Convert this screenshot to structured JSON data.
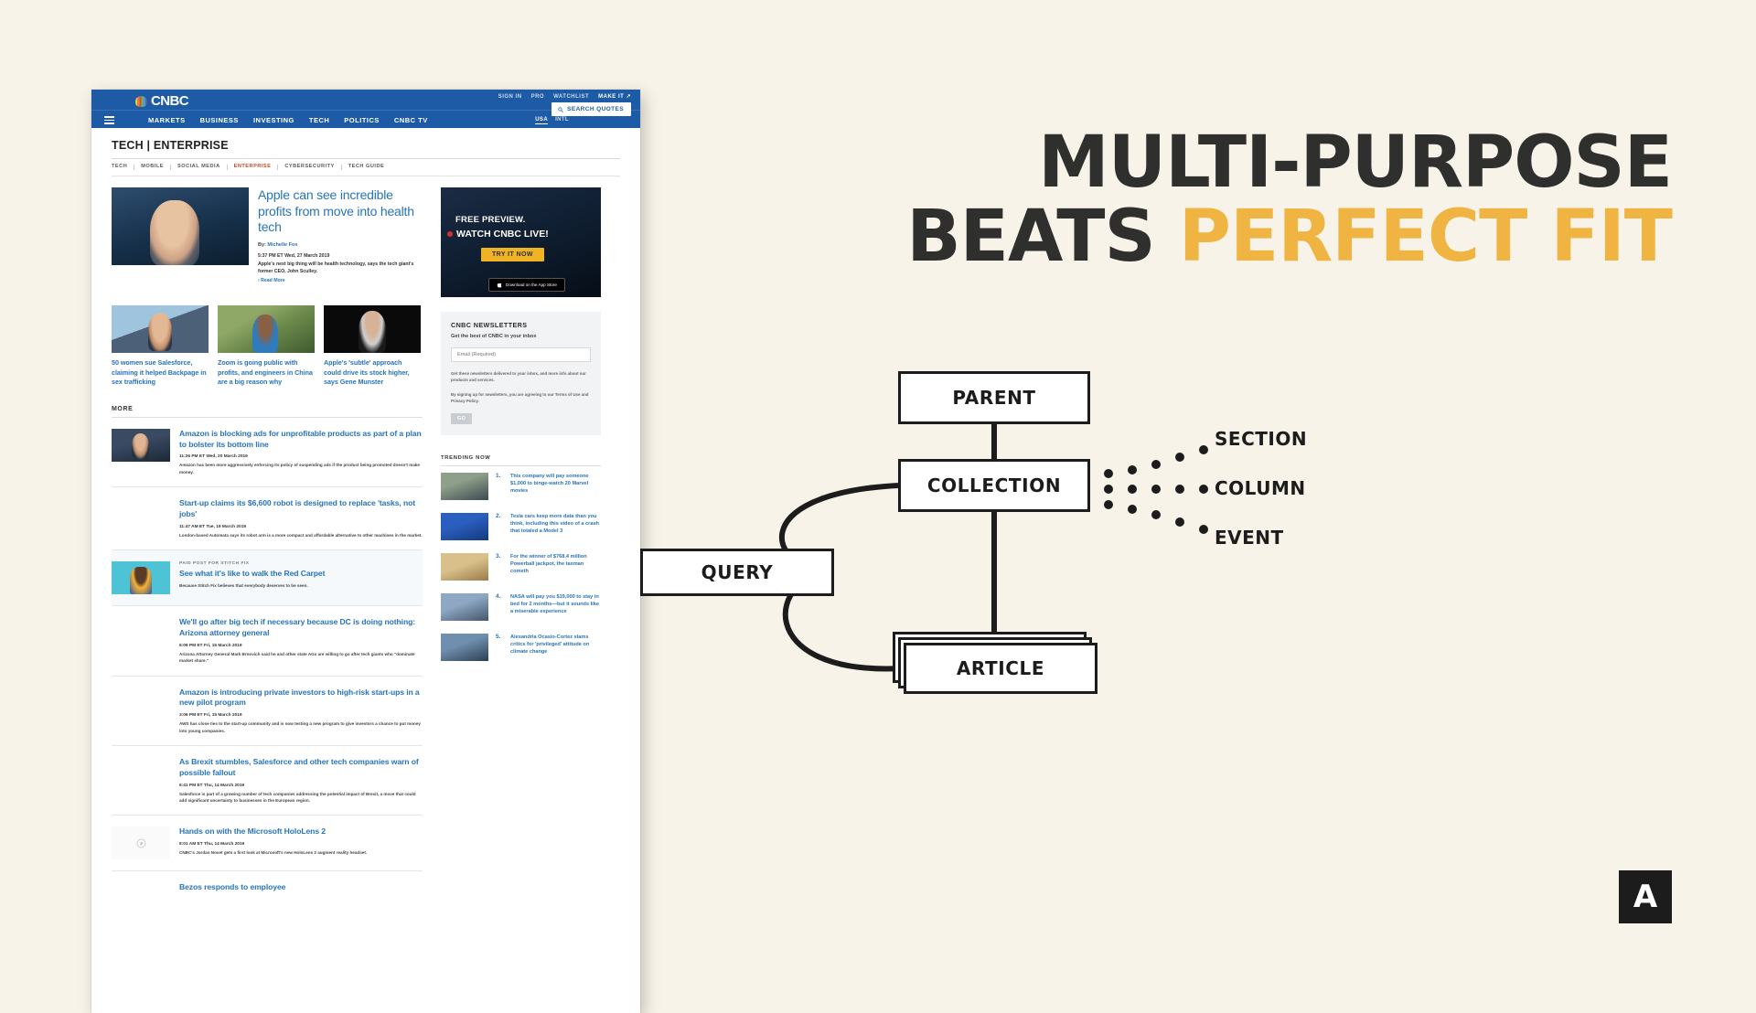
{
  "headline": {
    "line1": "MULTI-PURPOSE",
    "line2_dark": "BEATS ",
    "line2_accent": "PERFECT FIT"
  },
  "colors": {
    "background": "#f7f3e8",
    "accent": "#f0b442",
    "ink": "#2f2f2d",
    "cnbc_blue": "#1d5ba6",
    "link_blue": "#2774b9"
  },
  "diagram": {
    "nodes": [
      {
        "id": "parent",
        "label": "PARENT"
      },
      {
        "id": "collection",
        "label": "COLLECTION"
      },
      {
        "id": "query",
        "label": "QUERY"
      },
      {
        "id": "article",
        "label": "ARTICLE"
      }
    ],
    "legend": [
      "SECTION",
      "COLUMN",
      "EVENT"
    ]
  },
  "brand": {
    "mark": "A"
  },
  "browser": {
    "header": {
      "logo": "CNBC",
      "utility": [
        "SIGN IN",
        "PRO",
        "WATCHLIST",
        "MAKE IT ↗"
      ],
      "nav": [
        "MARKETS",
        "BUSINESS",
        "INVESTING",
        "TECH",
        "POLITICS",
        "CNBC TV"
      ],
      "locale": [
        "USA",
        "INTL"
      ],
      "locale_selected": "USA",
      "search_label": "SEARCH QUOTES"
    },
    "page": {
      "title": "TECH | ENTERPRISE",
      "subnav": [
        "TECH",
        "MOBILE",
        "SOCIAL MEDIA",
        "ENTERPRISE",
        "CYBERSECURITY",
        "TECH GUIDE"
      ],
      "subnav_selected": "ENTERPRISE",
      "hero": {
        "title": "Apple can see incredible profits from move into health tech",
        "by_label": "By:",
        "by_name": "Michelle Fox",
        "time": "5:37 PM ET Wed, 27 March 2019",
        "dek": "Apple's next big thing will be health technology, says the tech giant's former CEO, John Sculley.",
        "read_more": "› Read More"
      },
      "cards": [
        {
          "title": "50 women sue Salesforce, claiming it helped Backpage in sex trafficking"
        },
        {
          "title": "Zoom is going public with profits, and engineers in China are a big reason why"
        },
        {
          "title": "Apple's 'subtle' approach could drive its stock higher, says Gene Munster"
        }
      ],
      "more_label": "MORE",
      "articles": [
        {
          "title": "Amazon is blocking ads for unprofitable products as part of a plan to bolster its bottom line",
          "time": "11:26 PM ET Wed, 20 March 2019",
          "dek": "Amazon has been more aggressively enforcing its policy of suspending ads if the product being promoted doesn't make money."
        },
        {
          "title": "Start-up claims its $6,600 robot is designed to replace 'tasks, not jobs'",
          "time": "11:47 AM ET Tue, 19 March 2019",
          "dek": "London-based Automata says its robot arm is a more compact and affordable alternative to other machines in the market."
        },
        {
          "kicker": "PAID POST FOR STITCH FIX",
          "title": "See what it's like to walk the Red Carpet",
          "dek": "Because Stitch Fix believes that everybody deserves to be seen.",
          "paid": true
        },
        {
          "title": "We'll go after big tech if necessary because DC is doing nothing: Arizona attorney general",
          "time": "6:09 PM ET Fri, 15 March 2019",
          "dek": "Arizona Attorney General Mark Brnovich said he and other state AGs are willing to go after tech giants who \"dominate market share.\""
        },
        {
          "title": "Amazon is introducing private investors to high-risk start-ups in a new pilot program",
          "time": "3:06 PM ET Fri, 15 March 2019",
          "dek": "AWS has close ties to the start-up community and is now testing a new program to give investors a chance to put money into young companies."
        },
        {
          "title": "As Brexit stumbles, Salesforce and other tech companies warn of possible fallout",
          "time": "6:41 PM ET Thu, 14 March 2019",
          "dek": "Salesforce is part of a growing number of tech companies addressing the potential impact of Brexit, a move that could add significant uncertainty to businesses in the European region."
        },
        {
          "title": "Hands on with the Microsoft HoloLens 2",
          "time": "8:01 AM ET Thu, 14 March 2019",
          "dek": "CNBC's Jordan Novet gets a first look at Microsoft's new HoloLens 2 augment reality headset.",
          "video": true
        },
        {
          "title": "Bezos responds to employee"
        }
      ],
      "promo": {
        "line1": "FREE PREVIEW.",
        "line2": "WATCH CNBC LIVE!",
        "button": "TRY IT NOW",
        "store": "Download on the App Store"
      },
      "newsletter": {
        "title": "CNBC NEWSLETTERS",
        "subtitle": "Get the best of CNBC in your inbox",
        "placeholder": "Email (Required)",
        "fine1": "Get these newsletters delivered to your inbox, and more info about our products and services.",
        "fine2": "By signing up for newsletters, you are agreeing to our Terms of Use and Privacy Policy.",
        "submit": "GO"
      },
      "trending": {
        "title": "TRENDING NOW",
        "items": [
          {
            "rank": "1.",
            "title": "This company will pay someone $1,000 to binge-watch 20 Marvel movies"
          },
          {
            "rank": "2.",
            "title": "Tesla cars keep more data than you think, including this video of a crash that totaled a Model 3"
          },
          {
            "rank": "3.",
            "title": "For the winner of $768.4 million Powerball jackpot, the taxman cometh"
          },
          {
            "rank": "4.",
            "title": "NASA will pay you $19,000 to stay in bed for 2 months—but it sounds like a miserable experience"
          },
          {
            "rank": "5.",
            "title": "Alexandria Ocasio-Cortez slams critics for 'privileged' attitude on climate change"
          }
        ]
      }
    }
  }
}
